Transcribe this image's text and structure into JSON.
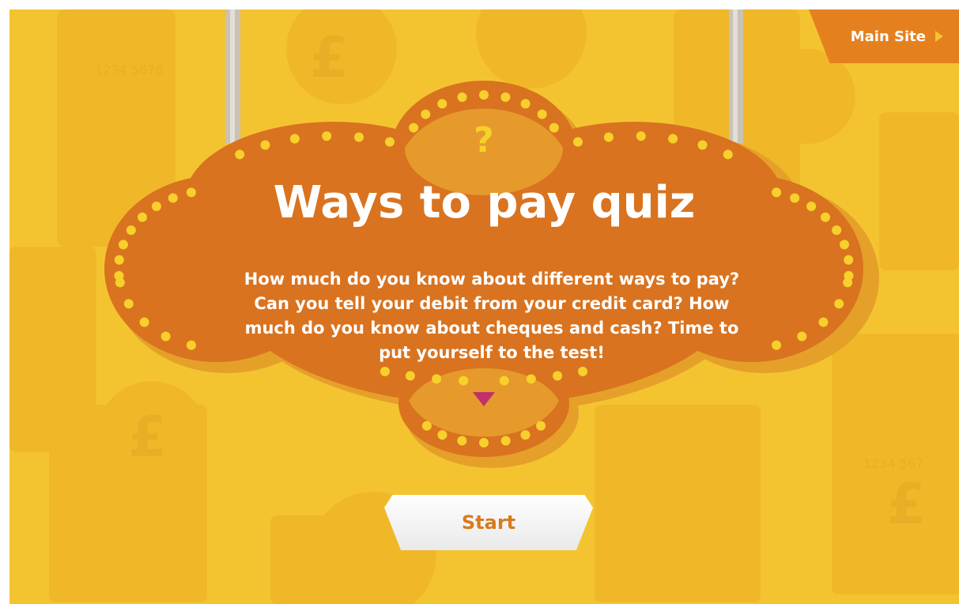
{
  "header": {
    "main_site_label": "Main Site"
  },
  "quiz": {
    "title": "Ways to pay quiz",
    "description": "How much do you know about different ways to pay? Can you tell your debit from your credit card? How much do you know about cheques and cash? Time to put yourself to the test!",
    "question_mark": "?",
    "start_label": "Start"
  },
  "background": {
    "card_number_1": "1234 5678",
    "card_number_2": "1234 567"
  },
  "colors": {
    "background": "#f4c430",
    "sign": "#d9731f",
    "sign_alt": "#e59a2b",
    "bulb": "#f8d02c",
    "button_text": "#d97a1e",
    "arrow": "#c0306a"
  }
}
